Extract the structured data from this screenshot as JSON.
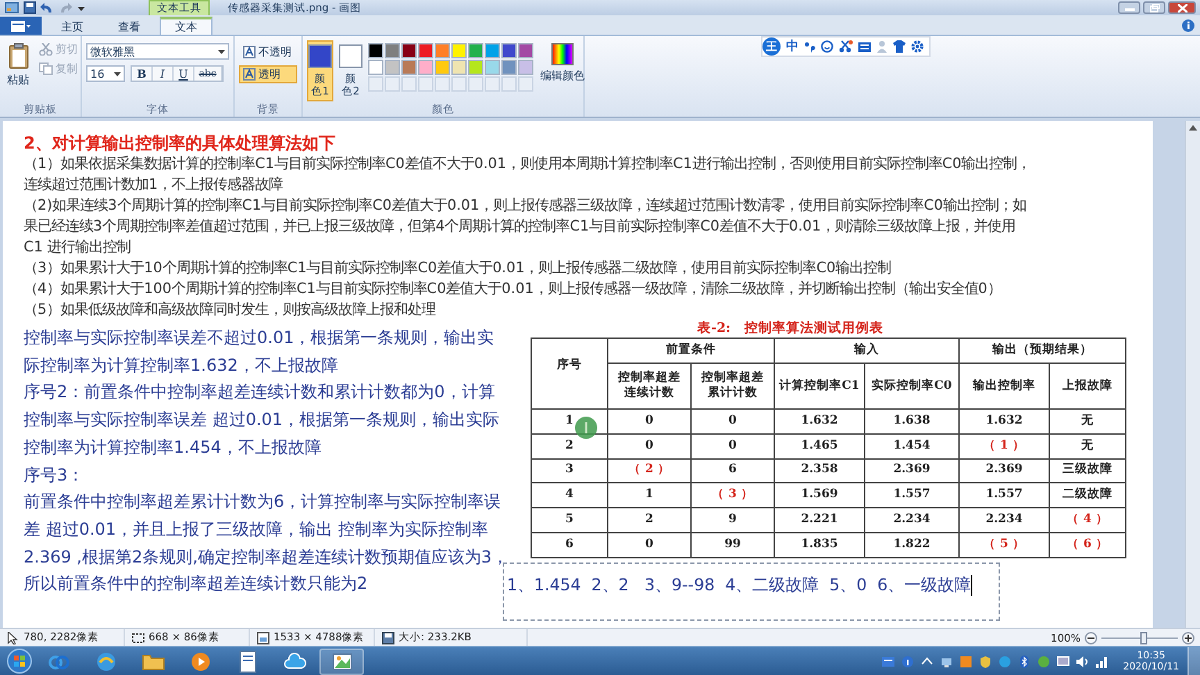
{
  "title_bar": {
    "context_tab": "文本工具",
    "title": "传感器采集测试.png - 画图"
  },
  "tabs": [
    {
      "label": "主页",
      "selected": false
    },
    {
      "label": "查看",
      "selected": false
    },
    {
      "label": "文本",
      "selected": true
    }
  ],
  "clipboard": {
    "label": "剪贴板",
    "paste": "粘贴",
    "cut": {
      "label": "剪切",
      "disabled": true
    },
    "copy": {
      "label": "复制",
      "disabled": true
    }
  },
  "font": {
    "label": "字体",
    "family": "微软雅黑",
    "size": "16",
    "styles": [
      {
        "label": "B",
        "kind": "bold"
      },
      {
        "label": "I",
        "kind": "italic"
      },
      {
        "label": "U",
        "kind": "underline"
      },
      {
        "label": "abc",
        "kind": "strike"
      }
    ]
  },
  "background": {
    "label": "背景",
    "options": [
      {
        "label": "不透明",
        "selected": false
      },
      {
        "label": "透明",
        "selected": true
      }
    ]
  },
  "colors": {
    "label": "颜色",
    "color1": {
      "label": "颜色1",
      "color": "#3346c8",
      "selected": true
    },
    "color2": {
      "label": "颜色2",
      "color": "#ffffff",
      "selected": false
    },
    "palette": [
      {
        "kind": "swatch",
        "color": "#000000"
      },
      {
        "kind": "swatch",
        "color": "#7f7f7f"
      },
      {
        "kind": "swatch",
        "color": "#880015"
      },
      {
        "kind": "swatch",
        "color": "#ed1c24"
      },
      {
        "kind": "swatch",
        "color": "#ff7f27"
      },
      {
        "kind": "swatch",
        "color": "#fff200"
      },
      {
        "kind": "swatch",
        "color": "#22b14c"
      },
      {
        "kind": "swatch",
        "color": "#00a2e8"
      },
      {
        "kind": "swatch",
        "color": "#3f48cc"
      },
      {
        "kind": "swatch",
        "color": "#a349a4"
      },
      {
        "kind": "swatch",
        "color": "#ffffff"
      },
      {
        "kind": "swatch",
        "color": "#c3c3c3"
      },
      {
        "kind": "swatch",
        "color": "#b97a57"
      },
      {
        "kind": "swatch",
        "color": "#ffaec9"
      },
      {
        "kind": "swatch",
        "color": "#ffc90e"
      },
      {
        "kind": "swatch",
        "color": "#efe4b0"
      },
      {
        "kind": "swatch",
        "color": "#b5e61d"
      },
      {
        "kind": "swatch",
        "color": "#99d9ea"
      },
      {
        "kind": "swatch",
        "color": "#7092be"
      },
      {
        "kind": "swatch",
        "color": "#c8bfe7"
      },
      {
        "kind": "empty"
      },
      {
        "kind": "empty"
      },
      {
        "kind": "empty"
      },
      {
        "kind": "empty"
      },
      {
        "kind": "empty"
      },
      {
        "kind": "empty"
      },
      {
        "kind": "empty"
      },
      {
        "kind": "empty"
      },
      {
        "kind": "empty"
      },
      {
        "kind": "empty"
      }
    ],
    "edit": "编辑颜色"
  },
  "ime_toolbar": {
    "badge": "王",
    "mode": "中"
  },
  "document": {
    "heading": "2、对计算输出控制率的具体处理算法如下",
    "rules": [
      "（1）如果依据采集数据计算的控制率C1与目前实际控制率C0差值不大于0.01，则使用本周期计算控制率C1进行输出控制，否则使用目前实际控制率C0输出控制，",
      "连续超过范围计数加1，不上报传感器故障",
      "（2)如果连续3个周期计算的控制率C1与目前实际控制率C0差值大于0.01，则上报传感器三级故障，连续超过范围计数清零，使用目前实际控制率C0输出控制；如",
      "果已经连续3个周期控制率差值超过范围，并已上报三级故障，但第4个周期计算的控制率C1与目前实际控制率C0差值不大于0.01，则清除三级故障上报，并使用",
      "C1 进行输出控制",
      "（3）如果累计大于10个周期计算的控制率C1与目前实际控制率C0差值大于0.01，则上报传感器二级故障，使用目前实际控制率C0输出控制",
      "（4）如果累计大于100个周期计算的控制率C1与目前实际控制率C0差值大于0.01，则上报传感器一级故障，清除二级故障，并切断输出控制（输出安全值0）",
      "（5）如果低级故障和高级故障同时发生，则按高级故障上报和处理"
    ],
    "notes": [
      "控制率与实际控制率误差不超过0.01，根据第一条规则，输出实",
      "际控制率为计算控制率1.632，不上报故障",
      "序号2：前置条件中控制率超差连续计数和累计计数都为0，计算",
      "控制率与实际控制率误差 超过0.01，根据第一条规则，输出实际",
      "控制率为计算控制率1.454，不上报故障",
      "序号3：",
      "前置条件中控制率超差累计计数为6，计算控制率与实际控制率误",
      "差 超过0.01，并且上报了三级故障，输出 控制率为实际控制率",
      "2.369 ,根据第2条规则,确定控制率超差连续计数预期值应该为3，",
      "所以前置条件中的控制率超差连续计数只能为2"
    ],
    "table": {
      "title": "表-2:   控制率算法测试用例表",
      "groups": [
        "前置条件",
        "输入",
        "输出（预期结果）"
      ],
      "columns": [
        "序号",
        "控制率超差连续计数",
        "控制率超差累计计数",
        "计算控制率C1",
        "实际控制率C0",
        "输出控制率",
        "上报故障"
      ],
      "rows": [
        [
          {
            "text": "1",
            "kind": "value"
          },
          {
            "text": "0",
            "kind": "value"
          },
          {
            "text": "0",
            "kind": "value"
          },
          {
            "text": "1.632",
            "kind": "value"
          },
          {
            "text": "1.638",
            "kind": "value"
          },
          {
            "text": "1.632",
            "kind": "value"
          },
          {
            "text": "无",
            "kind": "value"
          }
        ],
        [
          {
            "text": "2",
            "kind": "value"
          },
          {
            "text": "0",
            "kind": "value"
          },
          {
            "text": "0",
            "kind": "value"
          },
          {
            "text": "1.465",
            "kind": "value"
          },
          {
            "text": "1.454",
            "kind": "value"
          },
          {
            "text": "（ 1 ）",
            "kind": "blank"
          },
          {
            "text": "无",
            "kind": "value"
          }
        ],
        [
          {
            "text": "3",
            "kind": "value"
          },
          {
            "text": "（ 2 ）",
            "kind": "blank"
          },
          {
            "text": "6",
            "kind": "value"
          },
          {
            "text": "2.358",
            "kind": "value"
          },
          {
            "text": "2.369",
            "kind": "value"
          },
          {
            "text": "2.369",
            "kind": "value"
          },
          {
            "text": "三级故障",
            "kind": "value"
          }
        ],
        [
          {
            "text": "4",
            "kind": "value"
          },
          {
            "text": "1",
            "kind": "value"
          },
          {
            "text": "（ 3 ）",
            "kind": "blank"
          },
          {
            "text": "1.569",
            "kind": "value"
          },
          {
            "text": "1.557",
            "kind": "value"
          },
          {
            "text": "1.557",
            "kind": "value"
          },
          {
            "text": "二级故障",
            "kind": "value"
          }
        ],
        [
          {
            "text": "5",
            "kind": "value"
          },
          {
            "text": "2",
            "kind": "value"
          },
          {
            "text": "9",
            "kind": "value"
          },
          {
            "text": "2.221",
            "kind": "value"
          },
          {
            "text": "2.234",
            "kind": "value"
          },
          {
            "text": "2.234",
            "kind": "value"
          },
          {
            "text": "（ 4 ）",
            "kind": "blank"
          }
        ],
        [
          {
            "text": "6",
            "kind": "value"
          },
          {
            "text": "0",
            "kind": "value"
          },
          {
            "text": "99",
            "kind": "value"
          },
          {
            "text": "1.835",
            "kind": "value"
          },
          {
            "text": "1.822",
            "kind": "value"
          },
          {
            "text": "（ 5 ）",
            "kind": "blank"
          },
          {
            "text": "（ 6 ）",
            "kind": "blank"
          }
        ]
      ]
    },
    "answer_box": "1、1.454  2、2   3、9--98  4、二级故障  5、0  6、一级故障"
  },
  "status_bar": {
    "cursor": "780, 2282像素",
    "selection": "668 × 86像素",
    "image_size": "1533 × 4788像素",
    "file_size": "大小: 233.2KB",
    "zoom": "100%",
    "zoom_slider": {
      "level": 0.55
    }
  },
  "taskbar": {
    "time": "10:35",
    "date": "2020/10/11"
  }
}
